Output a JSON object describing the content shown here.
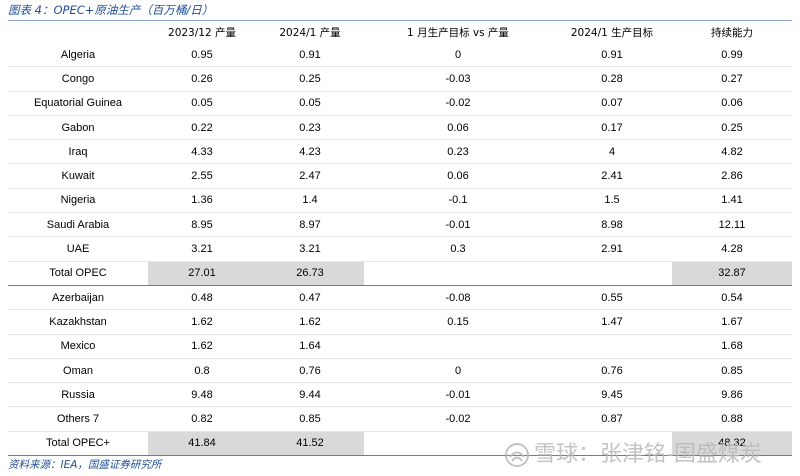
{
  "caption": "图表 4：OPEC+原油生产（百万桶/日）",
  "headers": [
    "",
    "2023/12 产量",
    "2024/1 产量",
    "1 月生产目标 vs 产量",
    "2024/1 生产目标",
    "持续能力"
  ],
  "opec_rows": [
    [
      "Algeria",
      "0.95",
      "0.91",
      "0",
      "0.91",
      "0.99"
    ],
    [
      "Congo",
      "0.26",
      "0.25",
      "-0.03",
      "0.28",
      "0.27"
    ],
    [
      "Equatorial Guinea",
      "0.05",
      "0.05",
      "-0.02",
      "0.07",
      "0.06"
    ],
    [
      "Gabon",
      "0.22",
      "0.23",
      "0.06",
      "0.17",
      "0.25"
    ],
    [
      "Iraq",
      "4.33",
      "4.23",
      "0.23",
      "4",
      "4.82"
    ],
    [
      "Kuwait",
      "2.55",
      "2.47",
      "0.06",
      "2.41",
      "2.86"
    ],
    [
      "Nigeria",
      "1.36",
      "1.4",
      "-0.1",
      "1.5",
      "1.41"
    ],
    [
      "Saudi Arabia",
      "8.95",
      "8.97",
      "-0.01",
      "8.98",
      "12.11"
    ],
    [
      "UAE",
      "3.21",
      "3.21",
      "0.3",
      "2.91",
      "4.28"
    ]
  ],
  "total_opec": [
    "Total OPEC",
    "27.01",
    "26.73",
    "",
    "",
    "32.87"
  ],
  "nonopec_rows": [
    [
      "Azerbaijan",
      "0.48",
      "0.47",
      "-0.08",
      "0.55",
      "0.54"
    ],
    [
      "Kazakhstan",
      "1.62",
      "1.62",
      "0.15",
      "1.47",
      "1.67"
    ],
    [
      "Mexico",
      "1.62",
      "1.64",
      "",
      "",
      "1.68"
    ],
    [
      "Oman",
      "0.8",
      "0.76",
      "0",
      "0.76",
      "0.85"
    ],
    [
      "Russia",
      "9.48",
      "9.44",
      "-0.01",
      "9.45",
      "9.86"
    ],
    [
      "Others 7",
      "0.82",
      "0.85",
      "-0.02",
      "0.87",
      "0.88"
    ]
  ],
  "total_opec_plus": [
    "Total OPEC+",
    "41.84",
    "41.52",
    "",
    "",
    "48.32"
  ],
  "source": "资料来源：IEA，国盛证券研究所",
  "watermark": "雪球：张津铭-国盛煤炭"
}
